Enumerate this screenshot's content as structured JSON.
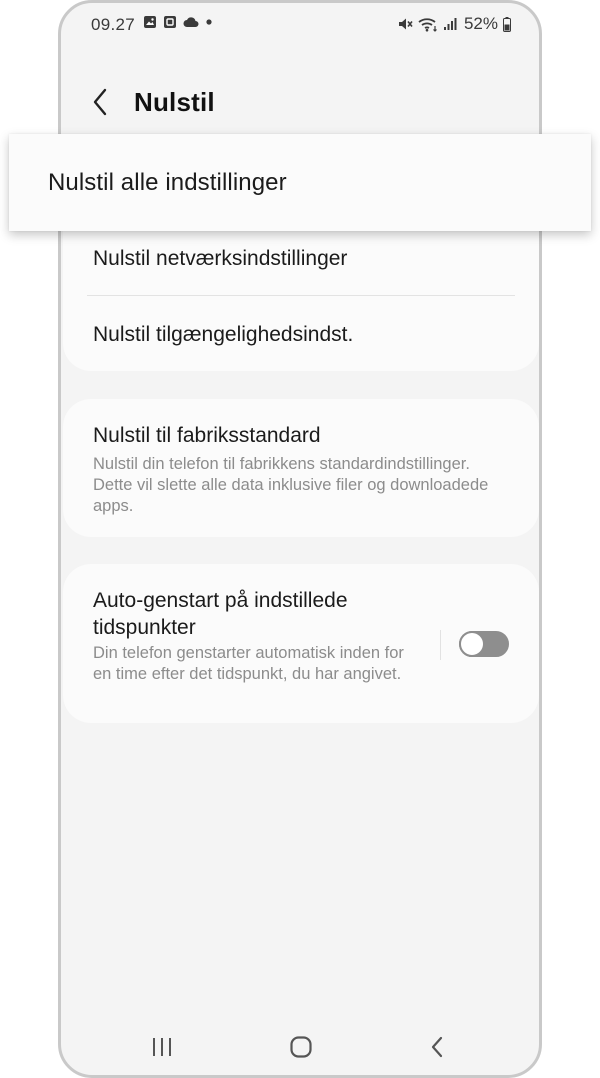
{
  "status_bar": {
    "time": "09.27",
    "battery_percent": "52%",
    "left_icons": [
      "image-icon",
      "screenshot-icon",
      "cloud-icon",
      "dot-icon"
    ],
    "right_icons": [
      "mute-icon",
      "wifi-icon",
      "signal-icon",
      "battery-icon"
    ]
  },
  "header": {
    "title": "Nulstil",
    "back_icon": "chevron-left-icon"
  },
  "popup": {
    "label": "Nulstil alle indstillinger"
  },
  "list": {
    "network_reset": "Nulstil netværksindstillinger",
    "accessibility_reset": "Nulstil tilgængelighedsindst.",
    "factory_reset": {
      "title": "Nulstil til fabriksstandard",
      "description": "Nulstil din telefon til fabrikkens standardindstillinger. Dette vil slette alle data inklusive filer og downloadede apps."
    },
    "auto_restart": {
      "title": "Auto-genstart på indstillede tidspunkter",
      "description": "Din telefon genstarter automatisk inden for en time efter det tidspunkt, du har angivet.",
      "enabled": false
    }
  },
  "navbar": {
    "icons": [
      "recent-apps-icon",
      "home-icon",
      "back-icon"
    ]
  },
  "colors": {
    "background": "#f4f4f4",
    "card": "#fbfbfb",
    "secondary_text": "#8c8c8c",
    "toggle_off": "#8e8e8e"
  }
}
